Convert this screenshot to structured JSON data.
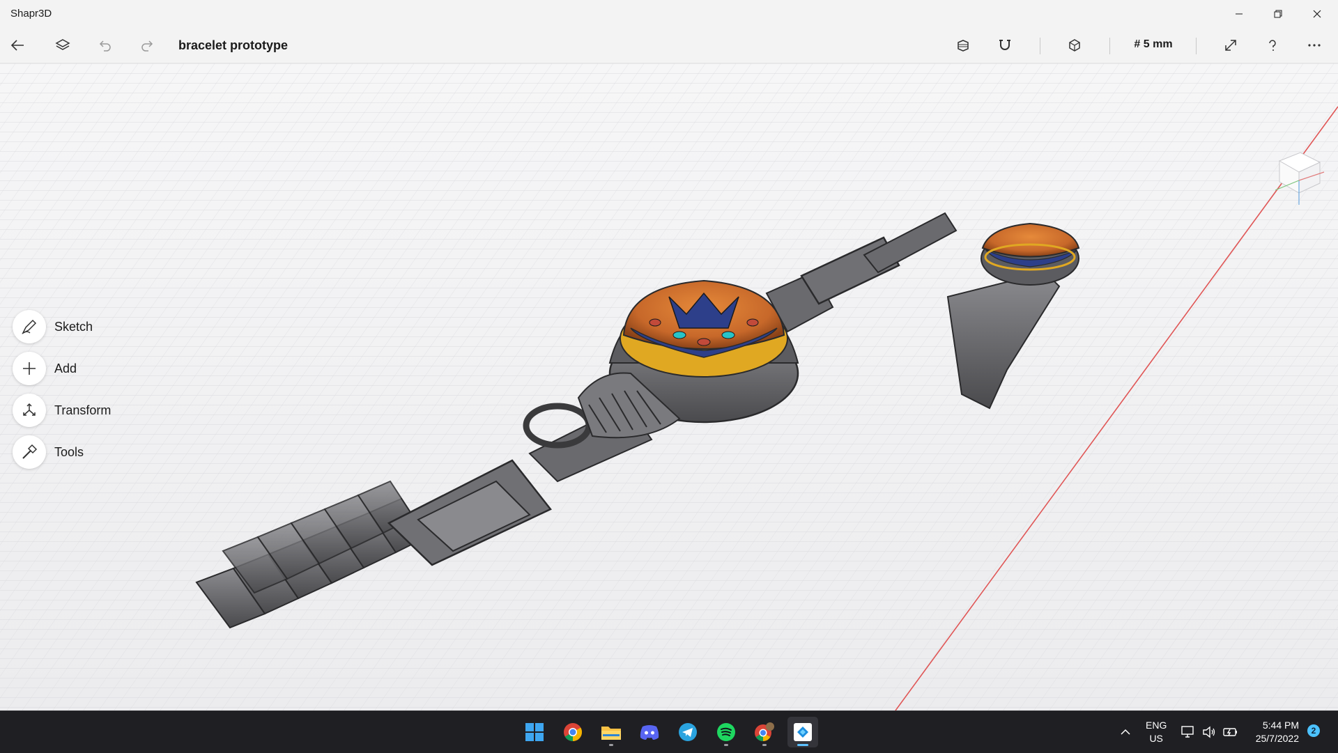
{
  "window": {
    "app_title": "Shapr3D"
  },
  "toolbar": {
    "document_title": "bracelet prototype",
    "grid_size": "# 5 mm"
  },
  "tools": [
    {
      "label": "Sketch",
      "icon": "sketch-pen-icon"
    },
    {
      "label": "Add",
      "icon": "plus-icon"
    },
    {
      "label": "Transform",
      "icon": "transform-arrows-icon"
    },
    {
      "label": "Tools",
      "icon": "hammer-icon"
    }
  ],
  "taskbar": {
    "apps": [
      "start",
      "chrome",
      "file-explorer",
      "discord",
      "telegram",
      "spotify",
      "chrome-profile",
      "shapr3d"
    ],
    "language_line1": "ENG",
    "language_line2": "US",
    "time": "5:44 PM",
    "date": "25/7/2022",
    "notification_count": "2"
  },
  "colors": {
    "dome_orange": "#d9792a",
    "dome_blue": "#2d3f8a",
    "dome_teal": "#27c4c8",
    "dome_red": "#c24a3a",
    "ring_gold": "#e0a822",
    "metal": "#5a5a5c",
    "axis_red": "#e05656",
    "accent_blue": "#4cc2ff"
  }
}
